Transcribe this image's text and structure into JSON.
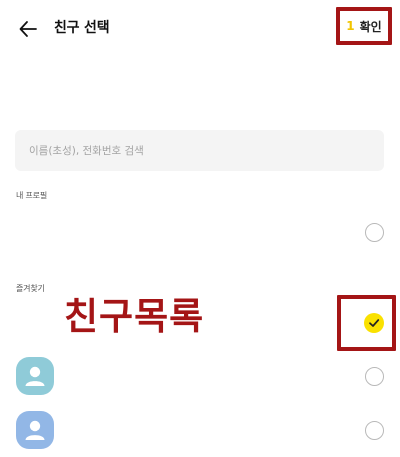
{
  "header": {
    "title": "친구 선택",
    "back_icon": "arrow-left-icon",
    "confirm_count": "1",
    "confirm_label": "확인"
  },
  "search": {
    "placeholder": "이름(초성), 전화번호 검색",
    "value": ""
  },
  "sections": {
    "my_profile_label": "내 프로필",
    "favorites_label": "즐겨찾기"
  },
  "annotation": {
    "text": "친구목록"
  },
  "friends": [
    {
      "selected": true
    },
    {
      "selected": false,
      "avatar_color": "#8fcbd8",
      "avatar_icon": "person-icon"
    },
    {
      "selected": false,
      "avatar_color": "#92b7e6",
      "avatar_icon": "person-icon"
    }
  ],
  "colors": {
    "accent_yellow": "#fae100",
    "count_yellow": "#f2c500",
    "annotation_red": "#a41516"
  }
}
